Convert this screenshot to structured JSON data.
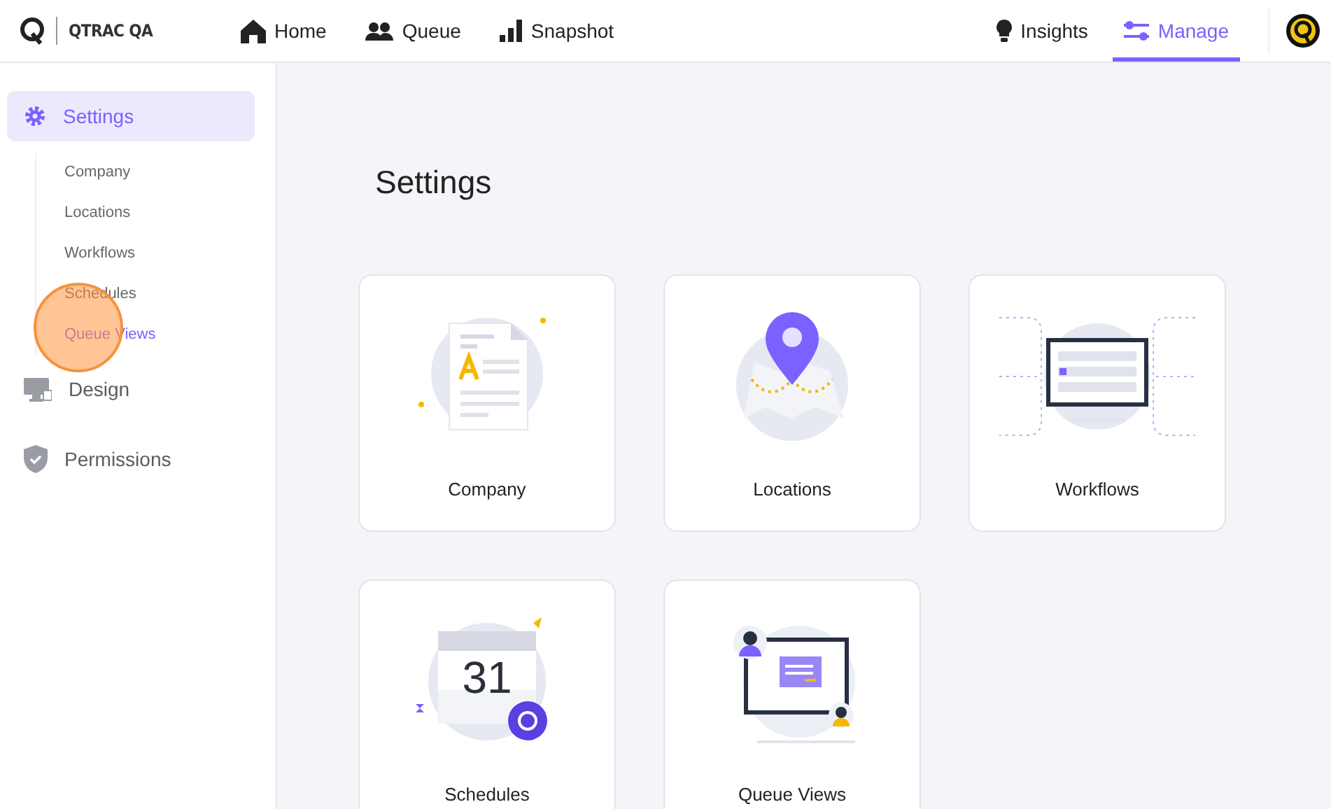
{
  "brand": {
    "title": "QTRAC QA"
  },
  "nav_left": [
    {
      "label": "Home",
      "kind": "home",
      "selected": false
    },
    {
      "label": "Queue",
      "kind": "people",
      "selected": false
    },
    {
      "label": "Snapshot",
      "kind": "bars",
      "selected": false
    }
  ],
  "nav_right": [
    {
      "label": "Insights",
      "kind": "bulb",
      "selected": false
    },
    {
      "label": "Manage",
      "kind": "sliders",
      "selected": true
    }
  ],
  "sidebar": {
    "items": [
      {
        "label": "Settings",
        "kind": "gear",
        "selected": true,
        "children": [
          {
            "label": "Company",
            "selected": false
          },
          {
            "label": "Locations",
            "selected": false
          },
          {
            "label": "Workflows",
            "selected": false
          },
          {
            "label": "Schedules",
            "selected": false
          },
          {
            "label": "Queue Views",
            "selected": true
          }
        ]
      },
      {
        "label": "Design",
        "kind": "monitor",
        "selected": false
      },
      {
        "label": "Permissions",
        "kind": "shield",
        "selected": false
      }
    ]
  },
  "page": {
    "title": "Settings"
  },
  "cards": [
    {
      "label": "Company",
      "kind": "document"
    },
    {
      "label": "Locations",
      "kind": "map"
    },
    {
      "label": "Workflows",
      "kind": "workflow"
    },
    {
      "label": "Schedules",
      "kind": "calendar",
      "day": "31"
    },
    {
      "label": "Queue Views",
      "kind": "screen"
    }
  ]
}
